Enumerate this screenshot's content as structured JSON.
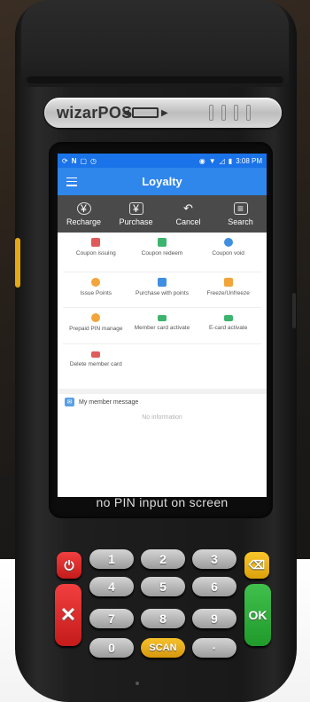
{
  "device": {
    "brand": "wizarPOS",
    "caption": "no PIN input on screen"
  },
  "status_bar": {
    "left_icons": [
      "sync-icon",
      "n-icon",
      "mail-icon",
      "clock-icon"
    ],
    "time": "3:08 PM"
  },
  "app_bar": {
    "title": "Loyalty"
  },
  "toolbar": {
    "items": [
      {
        "label": "Recharge",
        "icon": "¥"
      },
      {
        "label": "Purchase",
        "icon": "¥"
      },
      {
        "label": "Cancel",
        "icon": "↶"
      },
      {
        "label": "Search",
        "icon": "≡"
      }
    ]
  },
  "grid": {
    "items": [
      {
        "label": "Coupon issuing",
        "color": "#e05a5a"
      },
      {
        "label": "Coupon redeem",
        "color": "#3cb46e"
      },
      {
        "label": "Coupon void",
        "color": "#3f8fe0"
      },
      {
        "label": "Issue Points",
        "color": "#f2a53a"
      },
      {
        "label": "Purchase with points",
        "color": "#3f8fe0"
      },
      {
        "label": "Freeze/Unfreeze",
        "color": "#f2a53a"
      },
      {
        "label": "Prepaid PIN manage",
        "color": "#f2a53a"
      },
      {
        "label": "Member card activate",
        "color": "#3cb46e"
      },
      {
        "label": "E-card activate",
        "color": "#3cb46e"
      },
      {
        "label": "Delete member card",
        "color": "#e05a5a"
      }
    ]
  },
  "message_panel": {
    "title": "My member message",
    "empty_text": "No information"
  },
  "keypad": {
    "keys": {
      "cancel": "⏻",
      "clear": "⌫",
      "back": "✕",
      "ok": "OK",
      "k1": "1",
      "k2": "2",
      "k3": "3",
      "k4": "4",
      "k5": "5",
      "k6": "6",
      "k7": "7",
      "k8": "8",
      "k9": "9",
      "k0": "0",
      "scan": "SCAN",
      "dot": "·"
    }
  },
  "colors": {
    "status_bar": "#1a73e8",
    "app_bar": "#2f86eb",
    "toolbar": "#4a4a4a",
    "key_red": "#e02f2f",
    "key_yellow": "#f0b91f",
    "key_green": "#2eae3b"
  }
}
